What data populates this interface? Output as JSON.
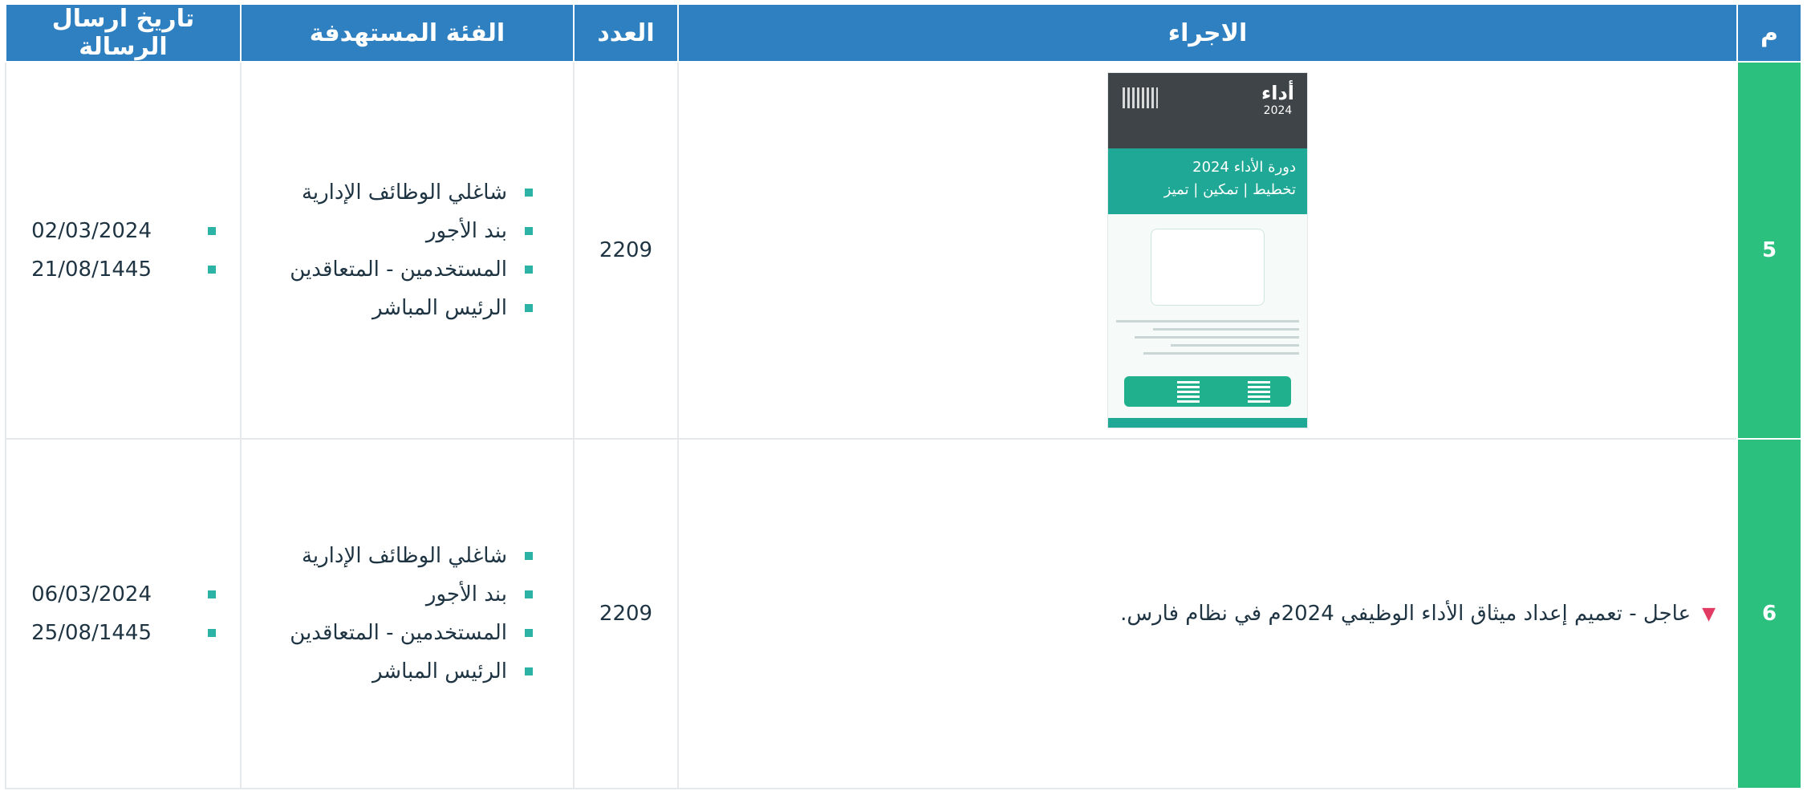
{
  "table": {
    "headers": {
      "num": "م",
      "action": "الاجراء",
      "count": "العدد",
      "target": "الفئة المستهدفة",
      "date": "تاريخ ارسال الرسالة"
    },
    "rows": [
      {
        "num": "5",
        "action_type": "image",
        "poster": {
          "logo_title": "أداء",
          "logo_year": "2024",
          "band_line1": "دورة الأداء 2024",
          "band_line2": "تخطيط | تمكين | تميز"
        },
        "count": "2209",
        "targets": [
          "شاغلي الوظائف الإدارية",
          "بند الأجور",
          "المستخدمين - المتعاقدين",
          "الرئيس المباشر"
        ],
        "dates": [
          "02/03/2024",
          "21/08/1445"
        ]
      },
      {
        "num": "6",
        "action_type": "text",
        "action_text": "عاجل - تعميم إعداد ميثاق الأداء الوظيفي 2024م في نظام فارس.",
        "count": "2209",
        "targets": [
          "شاغلي الوظائف الإدارية",
          "بند الأجور",
          "المستخدمين - المتعاقدين",
          "الرئيس المباشر"
        ],
        "dates": [
          "06/03/2024",
          "25/08/1445"
        ]
      }
    ]
  },
  "colors": {
    "header_bg": "#2f80c0",
    "num_bg": "#2cc07e",
    "bullet": "#2cb3a6",
    "urgent_marker": "#e23b63"
  }
}
